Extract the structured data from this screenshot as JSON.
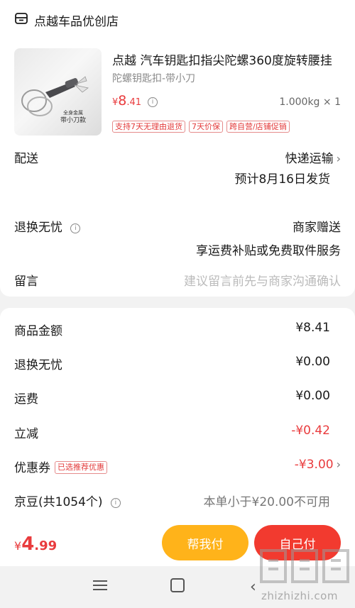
{
  "shop": {
    "name": "点越车品优创店",
    "icon": "store-icon"
  },
  "product": {
    "title": "点越 汽车钥匙扣指尖陀螺360度旋转腰挂",
    "spec": "陀螺钥匙扣-带小刀",
    "price_currency": "¥",
    "price_int": "8",
    "price_dec": ".41",
    "quantity": "1.000kg × 1",
    "image_caption_small": "全身金属",
    "image_caption_big": "带小刀款",
    "tags": [
      "支持7天无理由退货",
      "7天价保",
      "跨自营/店铺促销"
    ]
  },
  "delivery": {
    "label": "配送",
    "method": "快递运输",
    "eta": "预计8月16日发货"
  },
  "returns": {
    "label": "退换无忧",
    "value": "商家赠送",
    "detail": "享运费补贴或免费取件服务"
  },
  "message": {
    "label": "留言",
    "placeholder": "建议留言前先与商家沟通确认"
  },
  "summary": {
    "goods_amount": {
      "label": "商品金额",
      "value": "¥8.41"
    },
    "returns_fee": {
      "label": "退换无忧",
      "value": "¥0.00"
    },
    "shipping": {
      "label": "运费",
      "value": "¥0.00"
    },
    "discount": {
      "label": "立减",
      "value": "-¥0.42"
    },
    "coupon": {
      "label": "优惠券",
      "badge": "已选推荐优惠",
      "value": "-¥3.00"
    },
    "jingdou": {
      "label": "京豆(共1054个)",
      "value": "本单小于¥20.00不可用"
    }
  },
  "footer": {
    "total_currency": "¥",
    "total_int": "4",
    "total_dec": ".99",
    "help_pay": "帮我付",
    "self_pay": "自己付"
  },
  "watermark": {
    "text": "zhizhizhi.com"
  },
  "colors": {
    "accent": "#e93b3d",
    "help_button": "#ffb31a",
    "self_button": "#f23a2f"
  }
}
